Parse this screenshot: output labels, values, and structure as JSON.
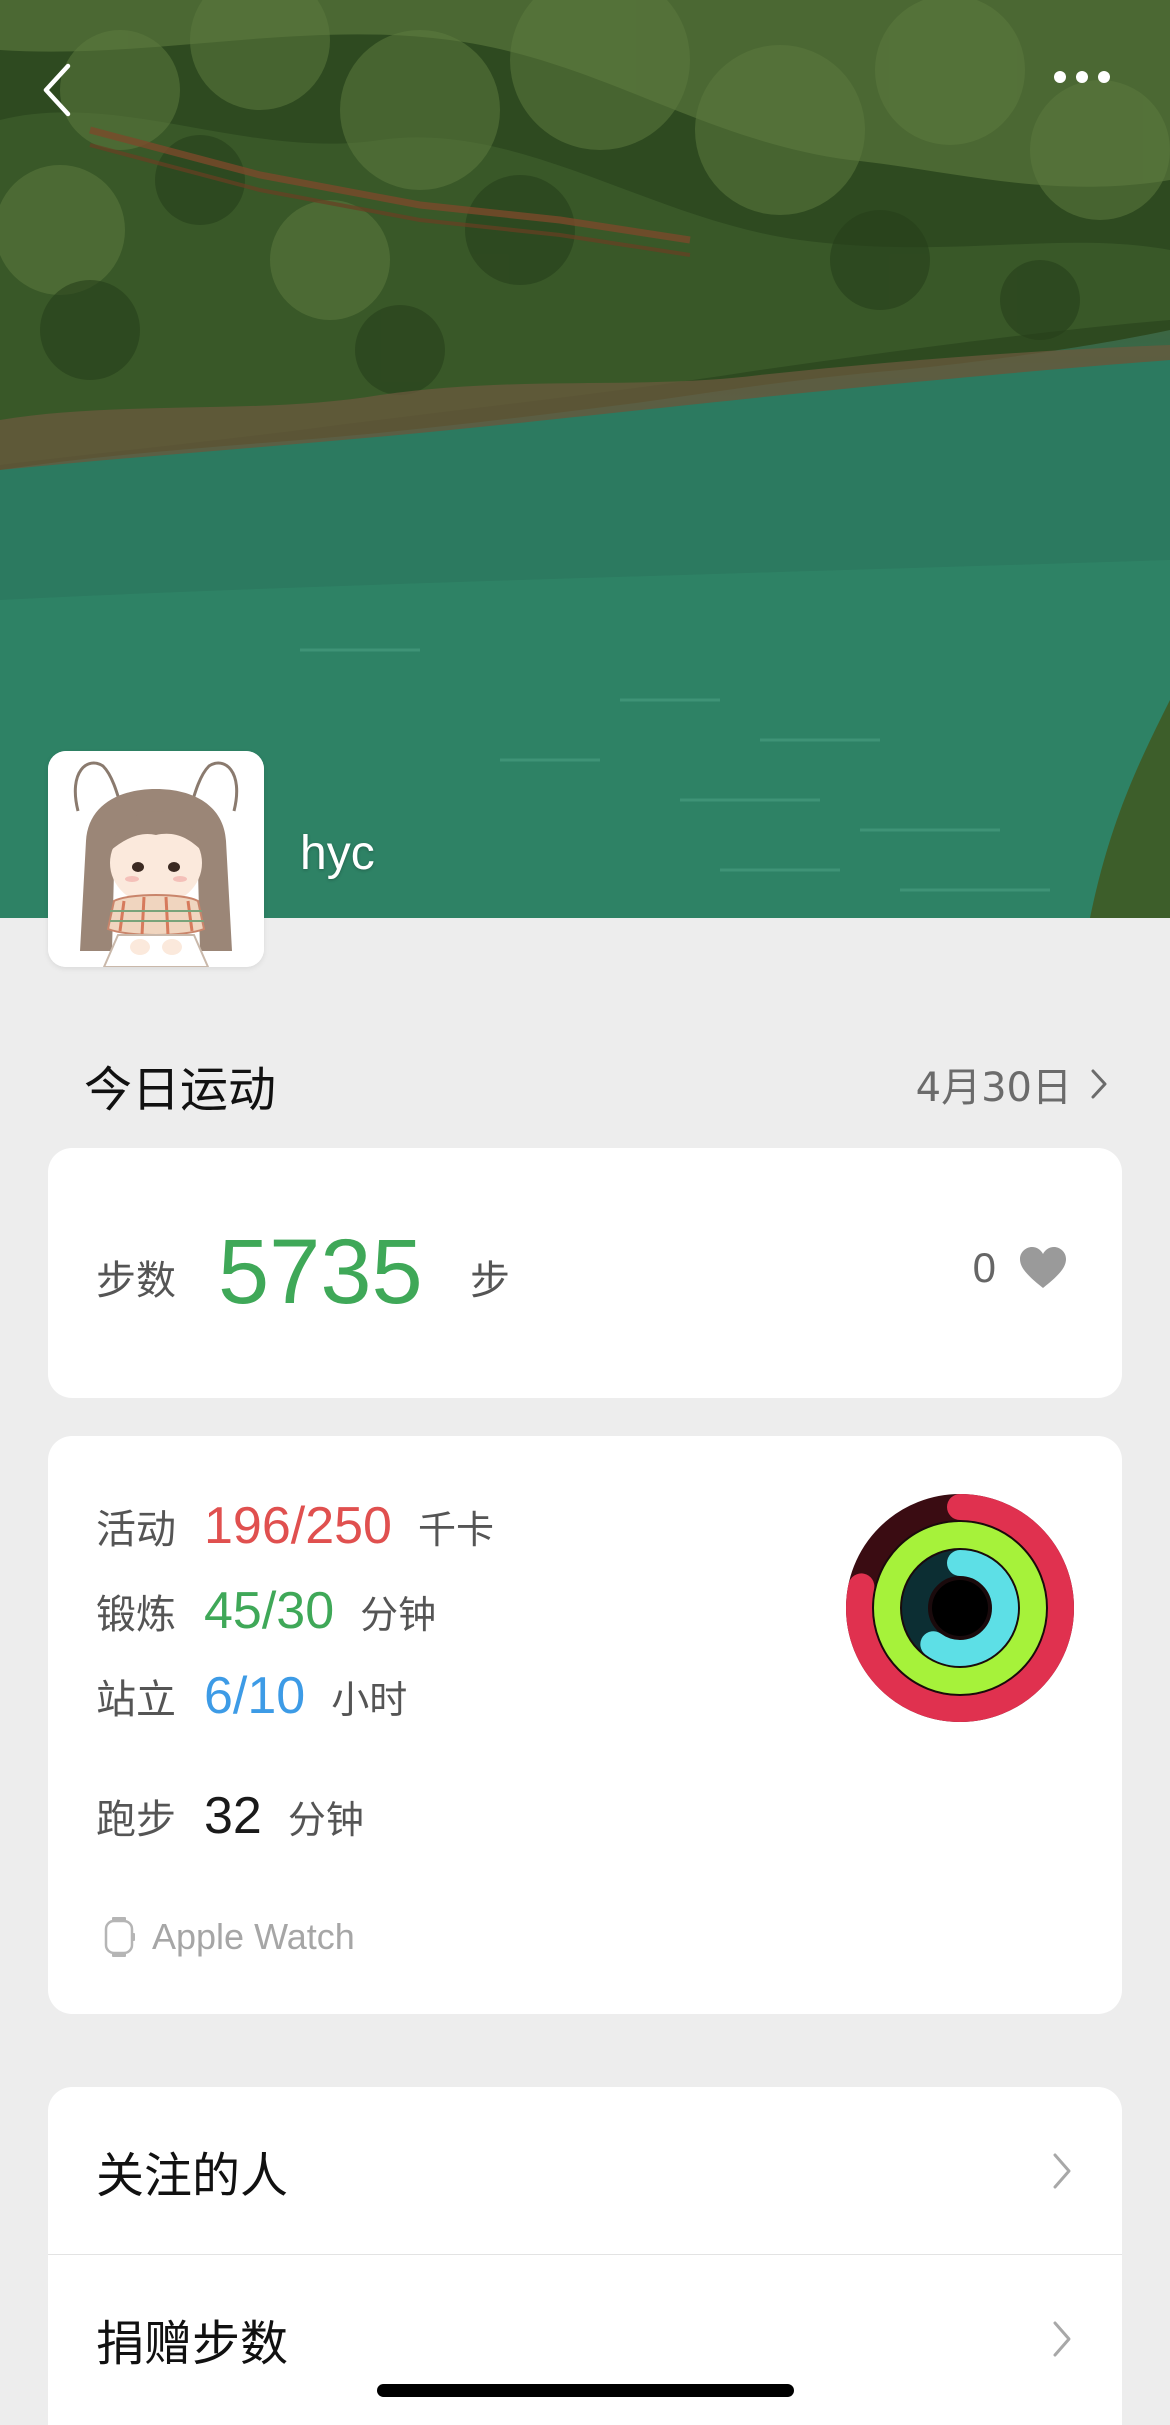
{
  "profile": {
    "username": "hyc"
  },
  "nav": {
    "back_icon": "chevron-left-icon",
    "more_icon": "more-dots-icon"
  },
  "today": {
    "title": "今日运动",
    "date": "4月30日"
  },
  "steps": {
    "label": "步数",
    "value": "5735",
    "unit": "步",
    "likes": "0",
    "value_color": "#3fa858"
  },
  "activity": {
    "move": {
      "label": "活动",
      "value": "196/250",
      "unit": "千卡",
      "color": "#e0504f",
      "progress": 0.784
    },
    "exercise": {
      "label": "锻炼",
      "value": "45/30",
      "unit": "分钟",
      "color": "#3fa858",
      "progress": 1.5
    },
    "stand": {
      "label": "站立",
      "value": "6/10",
      "unit": "小时",
      "color": "#3d9be6",
      "progress": 0.6
    },
    "run": {
      "label": "跑步",
      "value": "32",
      "unit": "分钟"
    },
    "device": "Apple Watch"
  },
  "menu": {
    "items": [
      {
        "label": "关注的人"
      },
      {
        "label": "捐赠步数"
      }
    ]
  }
}
